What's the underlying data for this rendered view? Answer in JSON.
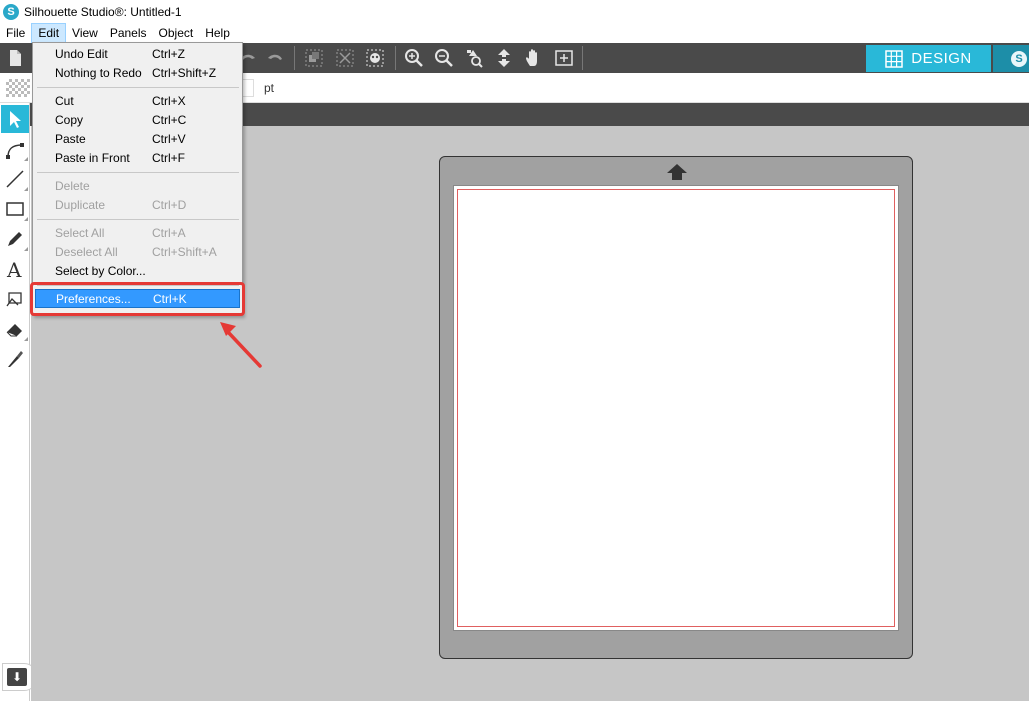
{
  "window": {
    "title": "Silhouette Studio®: Untitled-1",
    "logo_letter": "S"
  },
  "menubar": {
    "items": [
      "File",
      "Edit",
      "View",
      "Panels",
      "Object",
      "Help"
    ],
    "active": "Edit"
  },
  "toolbar": {
    "icons": [
      "new-document-icon",
      "undo-icon",
      "redo-icon",
      "group-icon",
      "ungroup-icon",
      "fill-pattern-icon",
      "zoom-in-icon",
      "zoom-out-icon",
      "zoom-selection-icon",
      "move-icon",
      "pan-hand-icon",
      "fit-to-page-icon"
    ],
    "design_label": "DESIGN",
    "store_logo_letter": "S"
  },
  "subbar": {
    "unit": "pt"
  },
  "tools": [
    "select-tool",
    "point-edit-tool",
    "line-tool",
    "rectangle-tool",
    "pencil-tool",
    "text-tool",
    "sketch-tool",
    "eraser-tool",
    "knife-tool"
  ],
  "edit_menu": {
    "items": [
      {
        "label": "Undo Edit",
        "shortcut": "Ctrl+Z",
        "disabled": false
      },
      {
        "label": "Nothing to Redo",
        "shortcut": "Ctrl+Shift+Z",
        "disabled": false
      },
      {
        "label": "Cut",
        "shortcut": "Ctrl+X",
        "disabled": false
      },
      {
        "label": "Copy",
        "shortcut": "Ctrl+C",
        "disabled": false
      },
      {
        "label": "Paste",
        "shortcut": "Ctrl+V",
        "disabled": false
      },
      {
        "label": "Paste in Front",
        "shortcut": "Ctrl+F",
        "disabled": false
      },
      {
        "label": "Delete",
        "shortcut": "",
        "disabled": true
      },
      {
        "label": "Duplicate",
        "shortcut": "Ctrl+D",
        "disabled": true
      },
      {
        "label": "Select All",
        "shortcut": "Ctrl+A",
        "disabled": true
      },
      {
        "label": "Deselect All",
        "shortcut": "Ctrl+Shift+A",
        "disabled": true
      },
      {
        "label": "Select by Color...",
        "shortcut": "",
        "disabled": false
      },
      {
        "label": "Preferences...",
        "shortcut": "Ctrl+K",
        "disabled": false,
        "highlighted": true
      }
    ]
  },
  "colors": {
    "accent": "#29b8d8",
    "toolbar_bg": "#4a4a4a",
    "workspace_bg": "#c6c6c6",
    "highlight_menu": "#3399ff",
    "annotation_red": "#e53935"
  }
}
